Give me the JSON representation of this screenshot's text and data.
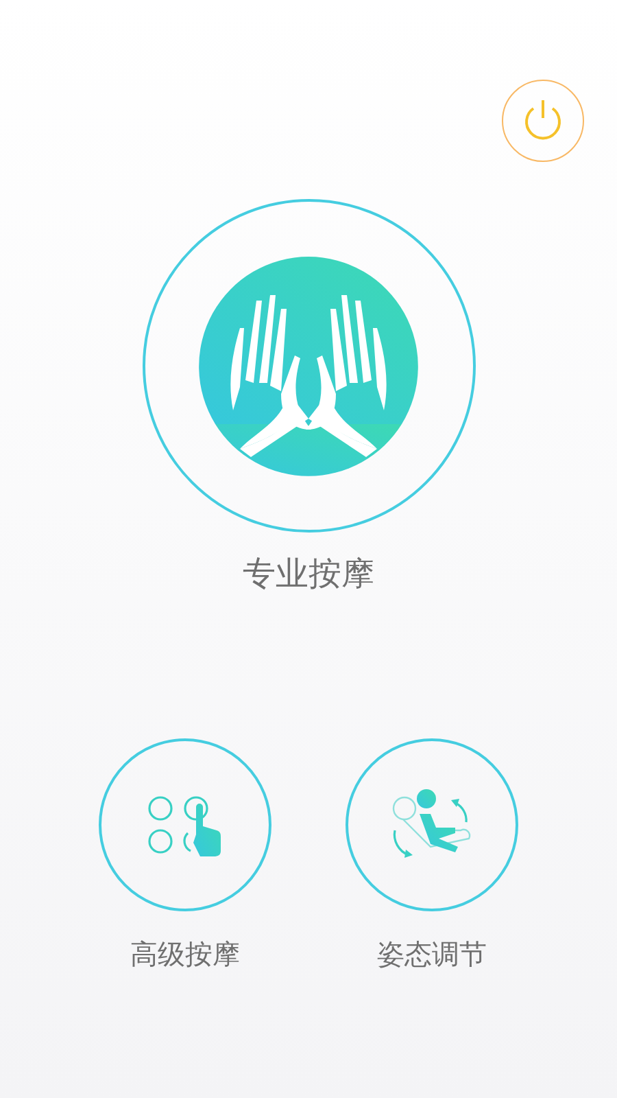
{
  "main_mode": {
    "label": "专业按摩",
    "kind": "hands"
  },
  "modes": [
    {
      "label": "高级按摩",
      "kind": "grid"
    },
    {
      "label": "姿态调节",
      "kind": "posture"
    }
  ]
}
